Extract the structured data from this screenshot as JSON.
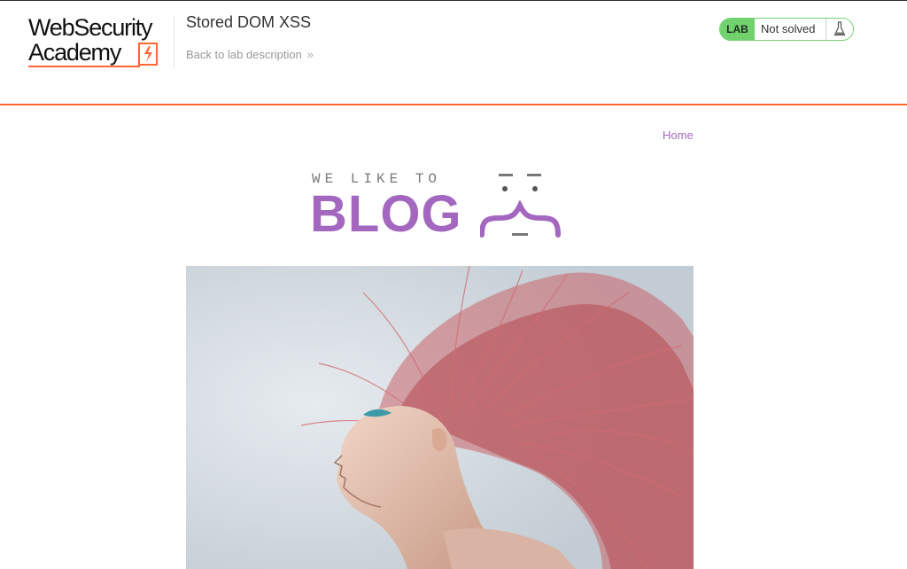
{
  "header": {
    "logo": {
      "line1": "WebSecurity",
      "line2": "Academy"
    },
    "lab_title": "Stored DOM XSS",
    "back_link": "Back to lab description",
    "back_chevron": "»",
    "status": {
      "badge": "LAB",
      "state": "Not solved",
      "icon": "flask-icon"
    }
  },
  "nav": {
    "home": "Home"
  },
  "blog": {
    "tagline": "WE LIKE TO",
    "word": "BLOG",
    "hero_image_alt": "woman-with-pink-hair"
  },
  "colors": {
    "accent_orange": "#ff6633",
    "status_green": "#70d16d",
    "blog_purple": "#a367c0",
    "link_gray": "#999999"
  }
}
